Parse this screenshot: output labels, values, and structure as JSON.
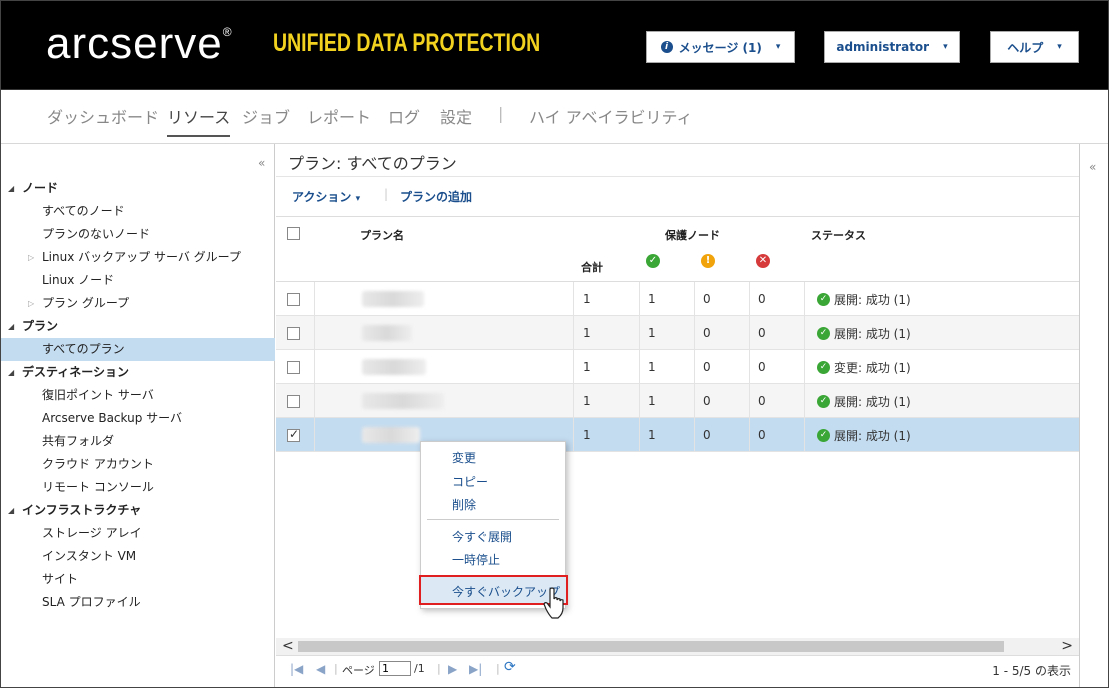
{
  "header": {
    "logo": "arcserve",
    "logo_mark": "®",
    "product": "UNIFIED DATA PROTECTION",
    "messages_label": "メッセージ (1)",
    "user_label": "administrator",
    "help_label": "ヘルプ",
    "caret": "▾"
  },
  "nav": {
    "dashboard": "ダッシュボード",
    "resources": "リソース",
    "jobs": "ジョブ",
    "reports": "レポート",
    "logs": "ログ",
    "settings": "設定",
    "separator": "|",
    "high_availability": "ハイ アベイラビリティ"
  },
  "sidebar": {
    "collapse": "«",
    "items": [
      {
        "label": "ノード",
        "kind": "cat"
      },
      {
        "label": "すべてのノード",
        "kind": "child"
      },
      {
        "label": "プランのないノード",
        "kind": "child"
      },
      {
        "label": "Linux バックアップ サーバ グループ",
        "kind": "child",
        "expander": "▷"
      },
      {
        "label": "Linux ノード",
        "kind": "child"
      },
      {
        "label": "プラン グループ",
        "kind": "child",
        "expander": "▷"
      },
      {
        "label": "プラン",
        "kind": "cat"
      },
      {
        "label": "すべてのプラン",
        "kind": "child",
        "selected": true
      },
      {
        "label": "デスティネーション",
        "kind": "cat"
      },
      {
        "label": "復旧ポイント サーバ",
        "kind": "child"
      },
      {
        "label": "Arcserve Backup サーバ",
        "kind": "child"
      },
      {
        "label": "共有フォルダ",
        "kind": "child"
      },
      {
        "label": "クラウド アカウント",
        "kind": "child"
      },
      {
        "label": "リモート コンソール",
        "kind": "child"
      },
      {
        "label": "インフラストラクチャ",
        "kind": "cat"
      },
      {
        "label": "ストレージ アレイ",
        "kind": "child"
      },
      {
        "label": "インスタント VM",
        "kind": "child"
      },
      {
        "label": "サイト",
        "kind": "child"
      },
      {
        "label": "SLA プロファイル",
        "kind": "child"
      }
    ]
  },
  "main": {
    "breadcrumb": "プラン: すべてのプラン",
    "action_label": "アクション",
    "action_caret": "▾",
    "toolbar_sep": "|",
    "add_plan_label": "プランの追加",
    "columns": {
      "plan_name": "プラン名",
      "protected_nodes": "保護ノード",
      "status": "ステータス",
      "total": "合計"
    },
    "rows": [
      {
        "total": "1",
        "ok": "1",
        "warn": "0",
        "err": "0",
        "status": "展開: 成功 (1)",
        "checked": false,
        "alt": false,
        "blur_w": 62
      },
      {
        "total": "1",
        "ok": "1",
        "warn": "0",
        "err": "0",
        "status": "展開: 成功 (1)",
        "checked": false,
        "alt": true,
        "blur_w": 50
      },
      {
        "total": "1",
        "ok": "1",
        "warn": "0",
        "err": "0",
        "status": "変更: 成功 (1)",
        "checked": false,
        "alt": false,
        "blur_w": 64
      },
      {
        "total": "1",
        "ok": "1",
        "warn": "0",
        "err": "0",
        "status": "展開: 成功 (1)",
        "checked": false,
        "alt": true,
        "blur_w": 82
      },
      {
        "total": "1",
        "ok": "1",
        "warn": "0",
        "err": "0",
        "status": "展開: 成功 (1)",
        "checked": true,
        "selected": true,
        "blur_w": 58
      }
    ]
  },
  "context_menu": {
    "modify": "変更",
    "copy": "コピー",
    "delete": "削除",
    "deploy_now": "今すぐ展開",
    "pause": "一時停止",
    "backup_now": "今すぐバックアップ"
  },
  "pager": {
    "page_label": "ページ",
    "page_value": "1",
    "page_total": "/1",
    "info": "1 - 5/5 の表示"
  },
  "right_strip": {
    "collapse": "«"
  }
}
